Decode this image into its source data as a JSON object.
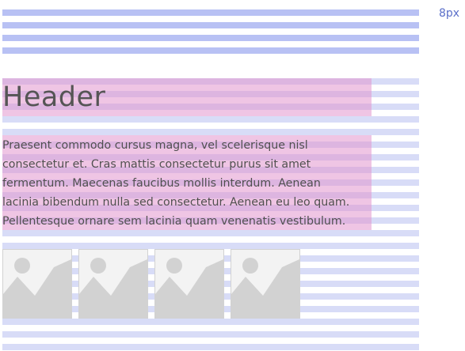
{
  "unit_label": "8px",
  "header": {
    "title": "Header"
  },
  "paragraph": {
    "lines": [
      "Praesent commodo cursus magna, vel scelerisque nisl",
      "consectetur et. Cras mattis consectetur purus sit amet",
      "fermentum. Maecenas faucibus mollis interdum. Aenean",
      "lacinia bibendum nulla sed consectetur. Aenean eu leo quam.",
      "Pellentesque ornare sem lacinia quam venenatis vestibulum."
    ]
  },
  "thumbnails": [
    {
      "icon": "image-placeholder-icon"
    },
    {
      "icon": "image-placeholder-icon"
    },
    {
      "icon": "image-placeholder-icon"
    },
    {
      "icon": "image-placeholder-icon"
    }
  ],
  "colors": {
    "grid_strong": "#b8c1f4",
    "grid_light": "#d8dcf7",
    "highlight": "#e296cd",
    "label": "#5b6fc9"
  }
}
